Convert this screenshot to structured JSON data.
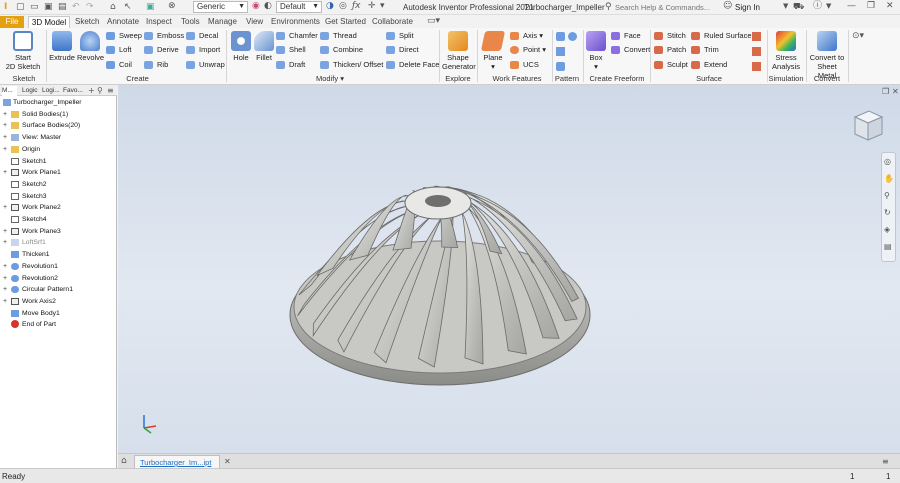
{
  "app_title": "Autodesk Inventor Professional 2021",
  "document_title": "Turbocharger_Impeller",
  "quick_access": {
    "appearance_value": "Generic",
    "material_value": "Default"
  },
  "search": {
    "placeholder": "Search Help & Commands..."
  },
  "account": {
    "sign_in": "Sign In"
  },
  "tabs": [
    {
      "label": "File"
    },
    {
      "label": "3D Model"
    },
    {
      "label": "Sketch"
    },
    {
      "label": "Annotate"
    },
    {
      "label": "Inspect"
    },
    {
      "label": "Tools"
    },
    {
      "label": "Manage"
    },
    {
      "label": "View"
    },
    {
      "label": "Environments"
    },
    {
      "label": "Get Started"
    },
    {
      "label": "Collaborate"
    }
  ],
  "ribbon": {
    "sketch": {
      "start_line1": "Start",
      "start_line2": "2D Sketch",
      "group": "Sketch"
    },
    "create": {
      "extrude": "Extrude",
      "revolve": "Revolve",
      "sweep": "Sweep",
      "loft": "Loft",
      "coil": "Coil",
      "emboss": "Emboss",
      "derive": "Derive",
      "rib": "Rib",
      "decal": "Decal",
      "import": "Import",
      "unwrap": "Unwrap",
      "group": "Create"
    },
    "modify": {
      "hole": "Hole",
      "fillet": "Fillet",
      "chamfer": "Chamfer",
      "shell": "Shell",
      "draft": "Draft",
      "thread": "Thread",
      "combine": "Combine",
      "thicken": "Thicken/ Offset",
      "split": "Split",
      "direct": "Direct",
      "delete_face": "Delete Face",
      "group": "Modify"
    },
    "explore": {
      "shape_line1": "Shape",
      "shape_line2": "Generator",
      "group": "Explore"
    },
    "work_features": {
      "plane": "Plane",
      "axis": "Axis",
      "point": "Point",
      "ucs": "UCS",
      "group": "Work Features"
    },
    "pattern": {
      "group": "Pattern"
    },
    "freeform": {
      "box": "Box",
      "face": "Face",
      "convert": "Convert",
      "group": "Create Freeform"
    },
    "surface": {
      "stitch": "Stitch",
      "patch": "Patch",
      "sculpt": "Sculpt",
      "ruled": "Ruled Surface",
      "trim": "Trim",
      "extend": "Extend",
      "group": "Surface"
    },
    "simulation": {
      "stress_line1": "Stress",
      "stress_line2": "Analysis",
      "group": "Simulation"
    },
    "convert": {
      "sheet_line1": "Convert to",
      "sheet_line2": "Sheet Metal",
      "group": "Convert"
    }
  },
  "browser": {
    "tabs": [
      "M...",
      "Logic",
      "Logi...",
      "Favo..."
    ],
    "items": [
      {
        "label": "Turbocharger_Impeller",
        "icon": "part-icon"
      },
      {
        "label": "Solid Bodies(1)",
        "icon": "folder-icon"
      },
      {
        "label": "Surface Bodies(20)",
        "icon": "folder-icon"
      },
      {
        "label": "View: Master",
        "icon": "view-icon"
      },
      {
        "label": "Origin",
        "icon": "folder-icon"
      },
      {
        "label": "Sketch1",
        "icon": "sketch-icon"
      },
      {
        "label": "Work Plane1",
        "icon": "work-plane-icon"
      },
      {
        "label": "Sketch2",
        "icon": "sketch-icon"
      },
      {
        "label": "Sketch3",
        "icon": "sketch-icon"
      },
      {
        "label": "Work Plane2",
        "icon": "work-plane-icon"
      },
      {
        "label": "Sketch4",
        "icon": "sketch-icon"
      },
      {
        "label": "Work Plane3",
        "icon": "work-plane-icon"
      },
      {
        "label": "LoftSrf1",
        "icon": "loft-icon"
      },
      {
        "label": "Thicken1",
        "icon": "thicken-icon"
      },
      {
        "label": "Revolution1",
        "icon": "revolve-icon"
      },
      {
        "label": "Revolution2",
        "icon": "revolve-icon"
      },
      {
        "label": "Circular Pattern1",
        "icon": "circular-pattern-icon"
      },
      {
        "label": "Work Axis2",
        "icon": "work-axis-icon"
      },
      {
        "label": "Move Body1",
        "icon": "move-body-icon"
      },
      {
        "label": "End of Part",
        "icon": "end-of-part-icon"
      }
    ]
  },
  "document_tab": {
    "label": "Turbocharger_Im...ipt"
  },
  "status": {
    "text": "Ready",
    "count1": "1",
    "count2": "1"
  },
  "colors": {
    "file_tab": "#e5a011",
    "accent": "#1f6fc5",
    "viewport_top": "#cfd9e8",
    "impeller": "#c9c9c6"
  }
}
